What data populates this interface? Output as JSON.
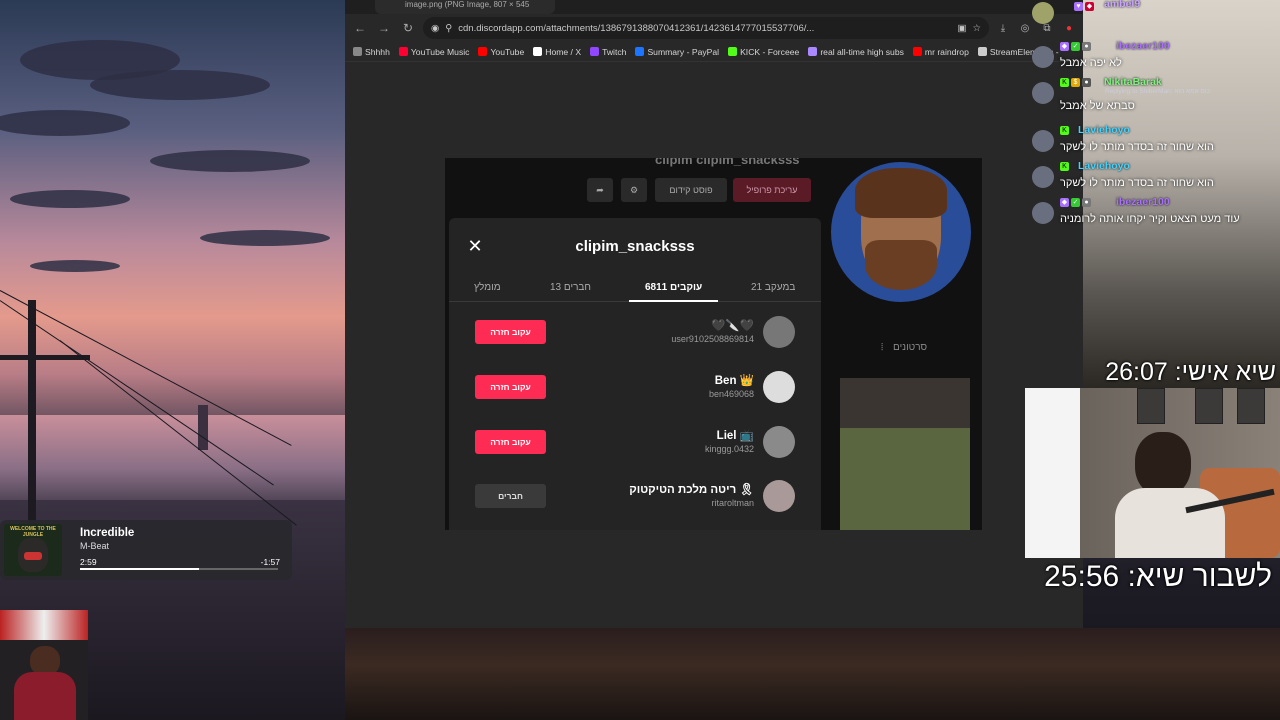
{
  "browser": {
    "tab_title": "image.png (PNG Image, 807 × 545",
    "url": "cdn.discordapp.com/attachments/1386791388070412361/1423614777015537706/...",
    "bookmarks": [
      {
        "label": "Shhhh",
        "icon": "folder-icon",
        "color": "#888888"
      },
      {
        "label": "YouTube Music",
        "icon": "youtube-music-icon",
        "color": "#ff0033"
      },
      {
        "label": "YouTube",
        "icon": "youtube-icon",
        "color": "#ff0000"
      },
      {
        "label": "Home / X",
        "icon": "x-icon",
        "color": "#ffffff"
      },
      {
        "label": "Twitch",
        "icon": "twitch-icon",
        "color": "#9146ff"
      },
      {
        "label": "Summary - PayPal",
        "icon": "paypal-icon",
        "color": "#1d74ff"
      },
      {
        "label": "KICK - Forceee",
        "icon": "kick-icon",
        "color": "#53fc18"
      },
      {
        "label": "real all-time high subs",
        "icon": "chart-icon",
        "color": "#aa88ff"
      },
      {
        "label": "mr raindrop",
        "icon": "youtube-icon",
        "color": "#ff0000"
      },
      {
        "label": "StreamElements -",
        "icon": "streamelements-icon",
        "color": "#cccccc"
      }
    ]
  },
  "tiktok": {
    "bg_handle": "clipim  clipim_snacksss",
    "bg_buttons": [
      "עריכת פרופיל",
      "פוסט קידום"
    ],
    "bg_tab": "סרטונים",
    "modal": {
      "title": "clipim_snacksss",
      "tabs": [
        {
          "label": "במעקב 21",
          "active": false
        },
        {
          "label": "עוקבים 6811",
          "active": true
        },
        {
          "label": "חברים 13",
          "active": false
        },
        {
          "label": "מומלץ",
          "active": false
        }
      ],
      "rows": [
        {
          "name": "🖤🔪🖤",
          "username": "user9102508869814",
          "button": "עקוב חזרה",
          "friends": false
        },
        {
          "name": "Ben 👑",
          "username": "ben469068",
          "button": "עקוב חזרה",
          "friends": false
        },
        {
          "name": "Liel 📺",
          "username": "kinggg.0432",
          "button": "עקוב חזרה",
          "friends": false
        },
        {
          "name": "ריטה מלכת הטיקטוק 🎗",
          "username": "ritaroltman",
          "button": "חברים",
          "friends": true
        }
      ]
    }
  },
  "chat": [
    {
      "user": "ambel9",
      "color": "#c8a6ff",
      "text": "",
      "reply": ""
    },
    {
      "user": "ibezaer100",
      "color": "#a970ff",
      "text": "לא יפה אמבל",
      "reply": ""
    },
    {
      "user": "NikitaBarak",
      "color": "#7cf27c",
      "text": "סבתא של אמבל",
      "reply": "Replying to ShiberMan: כוס אמא הוא"
    },
    {
      "user": "Laviehoyo",
      "color": "#3fd4ff",
      "text": "הוא שחור זה בסדר מותר לו לשקר",
      "reply": ""
    },
    {
      "user": "Laviehoyo",
      "color": "#3fd4ff",
      "text": "הוא שחור זה בסדר מותר לו לשקר",
      "reply": ""
    },
    {
      "user": "ibezaer100",
      "color": "#a970ff",
      "text": "עוד מעט הצאט וקיר יקחו אותה לרומניה",
      "reply": ""
    }
  ],
  "timers": {
    "personal": "שיא אישי: 26:07",
    "break": "לשבור שיא: 25:56"
  },
  "music": {
    "song": "Incredible",
    "artist": "M-Beat",
    "elapsed": "2:59",
    "remaining": "-1:57",
    "progress": 0.6,
    "album_text": "WELCOME TO THE JUNGLE"
  }
}
